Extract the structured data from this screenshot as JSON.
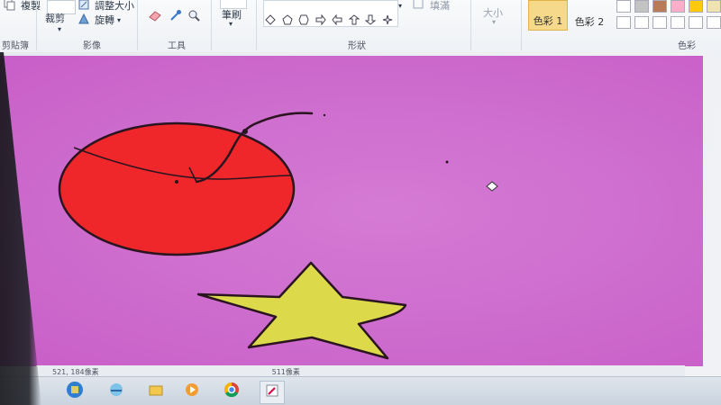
{
  "ribbon": {
    "clipboard_copy": "複製",
    "clipboard_group": "剪貼簿",
    "image_crop": "裁剪",
    "image_resize": "調整大小",
    "image_rotate": "旋轉",
    "image_group": "影像",
    "tools_group": "工具",
    "brushes_label": "筆刷",
    "shapes_group": "形狀",
    "fill_label": "填滿",
    "size_label": "大小",
    "color1_label": "色彩 1",
    "color2_label": "色彩 2",
    "colors_group": "色彩"
  },
  "colors": {
    "canvas": "#cf6fcf",
    "circle_fill": "#f0272a",
    "star_fill": "#dcd94a",
    "outline": "#2a1420",
    "color1_highlight": "#f6d98a"
  },
  "palette": [
    "#ffffff",
    "#c3c3c3",
    "#b97a57",
    "#ffaec9",
    "#ffc90e",
    "#efe4b0"
  ],
  "icons": {
    "resize": "resize-icon",
    "rotate": "rotate-icon",
    "eraser": "eraser-icon",
    "color_picker": "color-picker-icon",
    "magnifier": "magnifier-icon"
  },
  "status": {
    "position": "521, 184像素",
    "size": "511像素"
  }
}
